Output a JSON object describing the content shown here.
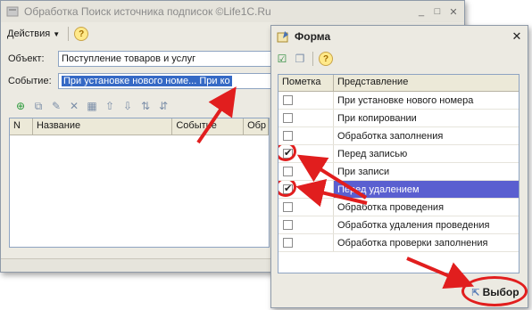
{
  "win1": {
    "title": "Обработка  Поиск источника подписок   ©Life1C.Ru",
    "menu_actions": "Действия",
    "object_label": "Объект:",
    "object_value": "Поступление товаров и услуг",
    "event_label": "Событие:",
    "event_value": "При установке нового номе... При ко",
    "columns": [
      "N",
      "Название",
      "Событие",
      "Обр"
    ]
  },
  "win2": {
    "title": "Форма",
    "col_mark": "Пометка",
    "col_repr": "Представление",
    "rows": [
      {
        "label": "При установке нового номера",
        "checked": false
      },
      {
        "label": "При копировании",
        "checked": false
      },
      {
        "label": "Обработка заполнения",
        "checked": false
      },
      {
        "label": "Перед записью",
        "checked": true
      },
      {
        "label": "При записи",
        "checked": false
      },
      {
        "label": "Перед удалением",
        "checked": true
      },
      {
        "label": "Обработка проведения",
        "checked": false
      },
      {
        "label": "Обработка удаления проведения",
        "checked": false
      },
      {
        "label": "Обработка проверки заполнения",
        "checked": false
      }
    ],
    "select_button": "Выбор"
  },
  "colors": {
    "accent": "#e11e1e",
    "selection": "#3569c5",
    "row_highlight": "#5a5fd0"
  }
}
